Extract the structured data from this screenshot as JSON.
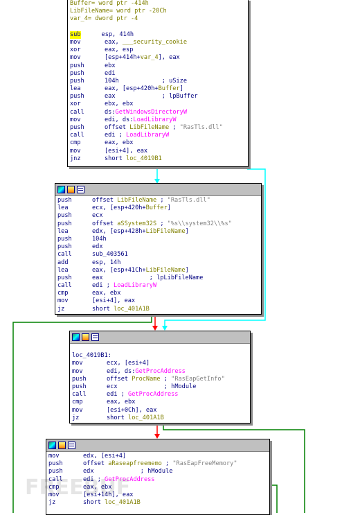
{
  "blocks": [
    {
      "id": "block-1",
      "titlebar": false,
      "lines": [
        [
          {
            "t": "Buffer= word ptr -414h",
            "c": "name"
          }
        ],
        [
          {
            "t": "LibFileName= word ptr -20Ch",
            "c": "name"
          }
        ],
        [
          {
            "t": "var_4= dword ptr -4",
            "c": "name"
          }
        ],
        [
          {
            "t": "",
            "c": ""
          }
        ],
        [
          {
            "t": "sub",
            "c": "hl",
            "m": 1
          },
          {
            "t": "esp, 414h",
            "c": ""
          }
        ],
        [
          {
            "t": "mov",
            "c": "",
            "m": 1
          },
          {
            "t": "eax, ",
            "c": ""
          },
          {
            "t": "___security_cookie",
            "c": "name"
          }
        ],
        [
          {
            "t": "xor",
            "c": "",
            "m": 1
          },
          {
            "t": "eax, esp",
            "c": ""
          }
        ],
        [
          {
            "t": "mov",
            "c": "",
            "m": 1
          },
          {
            "t": "[esp+414h+",
            "c": ""
          },
          {
            "t": "var_4",
            "c": "name"
          },
          {
            "t": "], eax",
            "c": ""
          }
        ],
        [
          {
            "t": "push",
            "c": "",
            "m": 1
          },
          {
            "t": "ebx",
            "c": ""
          }
        ],
        [
          {
            "t": "push",
            "c": "",
            "m": 1
          },
          {
            "t": "edi",
            "c": ""
          }
        ],
        [
          {
            "t": "push",
            "c": "",
            "m": 1
          },
          {
            "t": "104h            ",
            "c": ""
          },
          {
            "t": "; uSize",
            "c": ""
          }
        ],
        [
          {
            "t": "lea",
            "c": "",
            "m": 1
          },
          {
            "t": "eax, [esp+420h+",
            "c": ""
          },
          {
            "t": "Buffer",
            "c": "name"
          },
          {
            "t": "]",
            "c": ""
          }
        ],
        [
          {
            "t": "push",
            "c": "",
            "m": 1
          },
          {
            "t": "eax             ",
            "c": ""
          },
          {
            "t": "; lpBuffer",
            "c": ""
          }
        ],
        [
          {
            "t": "xor",
            "c": "",
            "m": 1
          },
          {
            "t": "ebx, ebx",
            "c": ""
          }
        ],
        [
          {
            "t": "call",
            "c": "",
            "m": 1
          },
          {
            "t": "ds:",
            "c": ""
          },
          {
            "t": "GetWindowsDirectoryW",
            "c": "api"
          }
        ],
        [
          {
            "t": "mov",
            "c": "",
            "m": 1
          },
          {
            "t": "edi, ds:",
            "c": ""
          },
          {
            "t": "LoadLibraryW",
            "c": "api"
          }
        ],
        [
          {
            "t": "push",
            "c": "",
            "m": 1
          },
          {
            "t": "offset ",
            "c": ""
          },
          {
            "t": "LibFileName",
            "c": "name"
          },
          {
            "t": " ; ",
            "c": ""
          },
          {
            "t": "\"RasTls.dll\"",
            "c": "cmt"
          }
        ],
        [
          {
            "t": "call",
            "c": "",
            "m": 1
          },
          {
            "t": "edi ; ",
            "c": ""
          },
          {
            "t": "LoadLibraryW",
            "c": "api"
          }
        ],
        [
          {
            "t": "cmp",
            "c": "",
            "m": 1
          },
          {
            "t": "eax, ebx",
            "c": ""
          }
        ],
        [
          {
            "t": "mov",
            "c": "",
            "m": 1
          },
          {
            "t": "[esi+4], eax",
            "c": ""
          }
        ],
        [
          {
            "t": "jnz",
            "c": "",
            "m": 1
          },
          {
            "t": "short ",
            "c": ""
          },
          {
            "t": "loc_4019B1",
            "c": "name"
          }
        ]
      ]
    },
    {
      "id": "block-2",
      "titlebar": true,
      "lines": [
        [
          {
            "t": "push",
            "c": "",
            "m": 1
          },
          {
            "t": "offset ",
            "c": ""
          },
          {
            "t": "LibFileName",
            "c": "name"
          },
          {
            "t": " ; ",
            "c": ""
          },
          {
            "t": "\"RasTls.dll\"",
            "c": "cmt"
          }
        ],
        [
          {
            "t": "lea",
            "c": "",
            "m": 1
          },
          {
            "t": "ecx, [esp+420h+",
            "c": ""
          },
          {
            "t": "Buffer",
            "c": "name"
          },
          {
            "t": "]",
            "c": ""
          }
        ],
        [
          {
            "t": "push",
            "c": "",
            "m": 1
          },
          {
            "t": "ecx",
            "c": ""
          }
        ],
        [
          {
            "t": "push",
            "c": "",
            "m": 1
          },
          {
            "t": "offset ",
            "c": ""
          },
          {
            "t": "aSSystem32S",
            "c": "name"
          },
          {
            "t": " ; ",
            "c": ""
          },
          {
            "t": "\"%s\\\\system32\\\\%s\"",
            "c": "cmt"
          }
        ],
        [
          {
            "t": "lea",
            "c": "",
            "m": 1
          },
          {
            "t": "edx, [esp+428h+",
            "c": ""
          },
          {
            "t": "LibFileName",
            "c": "name"
          },
          {
            "t": "]",
            "c": ""
          }
        ],
        [
          {
            "t": "push",
            "c": "",
            "m": 1
          },
          {
            "t": "104h",
            "c": ""
          }
        ],
        [
          {
            "t": "push",
            "c": "",
            "m": 1
          },
          {
            "t": "edx",
            "c": ""
          }
        ],
        [
          {
            "t": "call",
            "c": "",
            "m": 1
          },
          {
            "t": "sub_403561",
            "c": ""
          }
        ],
        [
          {
            "t": "add",
            "c": "",
            "m": 1
          },
          {
            "t": "esp, 14h",
            "c": ""
          }
        ],
        [
          {
            "t": "lea",
            "c": "",
            "m": 1
          },
          {
            "t": "eax, [esp+41Ch+",
            "c": ""
          },
          {
            "t": "LibFileName",
            "c": "name"
          },
          {
            "t": "]",
            "c": ""
          }
        ],
        [
          {
            "t": "push",
            "c": "",
            "m": 1
          },
          {
            "t": "eax             ",
            "c": ""
          },
          {
            "t": "; lpLibFileName",
            "c": ""
          }
        ],
        [
          {
            "t": "call",
            "c": "",
            "m": 1
          },
          {
            "t": "edi ; ",
            "c": ""
          },
          {
            "t": "LoadLibraryW",
            "c": "api"
          }
        ],
        [
          {
            "t": "cmp",
            "c": "",
            "m": 1
          },
          {
            "t": "eax, ebx",
            "c": ""
          }
        ],
        [
          {
            "t": "mov",
            "c": "",
            "m": 1
          },
          {
            "t": "[esi+4], eax",
            "c": ""
          }
        ],
        [
          {
            "t": "jz",
            "c": "",
            "m": 1
          },
          {
            "t": "short ",
            "c": ""
          },
          {
            "t": "loc_401A1B",
            "c": "name"
          }
        ]
      ]
    },
    {
      "id": "block-3",
      "titlebar": true,
      "lines": [
        [
          {
            "t": "",
            "c": ""
          }
        ],
        [
          {
            "t": "loc_4019B1:",
            "c": ""
          }
        ],
        [
          {
            "t": "mov",
            "c": "",
            "m": 1
          },
          {
            "t": "ecx, [esi+4]",
            "c": ""
          }
        ],
        [
          {
            "t": "mov",
            "c": "",
            "m": 1
          },
          {
            "t": "edi, ds:",
            "c": ""
          },
          {
            "t": "GetProcAddress",
            "c": "api"
          }
        ],
        [
          {
            "t": "push",
            "c": "",
            "m": 1
          },
          {
            "t": "offset ",
            "c": ""
          },
          {
            "t": "ProcName",
            "c": "name"
          },
          {
            "t": " ; ",
            "c": ""
          },
          {
            "t": "\"RasEapGetInfo\"",
            "c": "cmt"
          }
        ],
        [
          {
            "t": "push",
            "c": "",
            "m": 1
          },
          {
            "t": "ecx             ",
            "c": ""
          },
          {
            "t": "; hModule",
            "c": ""
          }
        ],
        [
          {
            "t": "call",
            "c": "",
            "m": 1
          },
          {
            "t": "edi ; ",
            "c": ""
          },
          {
            "t": "GetProcAddress",
            "c": "api"
          }
        ],
        [
          {
            "t": "cmp",
            "c": "",
            "m": 1
          },
          {
            "t": "eax, ebx",
            "c": ""
          }
        ],
        [
          {
            "t": "mov",
            "c": "",
            "m": 1
          },
          {
            "t": "[esi+0Ch], eax",
            "c": ""
          }
        ],
        [
          {
            "t": "jz",
            "c": "",
            "m": 1
          },
          {
            "t": "short ",
            "c": ""
          },
          {
            "t": "loc_401A1B",
            "c": "name"
          }
        ]
      ]
    },
    {
      "id": "block-4",
      "titlebar": true,
      "lines": [
        [
          {
            "t": "mov",
            "c": "",
            "m": 1
          },
          {
            "t": "edx, [esi+4]",
            "c": ""
          }
        ],
        [
          {
            "t": "push",
            "c": "",
            "m": 1
          },
          {
            "t": "offset ",
            "c": ""
          },
          {
            "t": "aRaseapfreememo",
            "c": "name"
          },
          {
            "t": " ; ",
            "c": ""
          },
          {
            "t": "\"RasEapFreeMemory\"",
            "c": "cmt"
          }
        ],
        [
          {
            "t": "push",
            "c": "",
            "m": 1
          },
          {
            "t": "edx             ",
            "c": ""
          },
          {
            "t": "; hModule",
            "c": ""
          }
        ],
        [
          {
            "t": "call",
            "c": "",
            "m": 1
          },
          {
            "t": "edi ; ",
            "c": ""
          },
          {
            "t": "GetProcAddress",
            "c": "api"
          }
        ],
        [
          {
            "t": "cmp",
            "c": "",
            "m": 1
          },
          {
            "t": "eax, ebx",
            "c": ""
          }
        ],
        [
          {
            "t": "mov",
            "c": "",
            "m": 1
          },
          {
            "t": "[esi+14h], eax",
            "c": ""
          }
        ],
        [
          {
            "t": "jz",
            "c": "",
            "m": 1
          },
          {
            "t": "short ",
            "c": ""
          },
          {
            "t": "loc_401A1B",
            "c": "name"
          }
        ]
      ]
    }
  ],
  "edge_colors": {
    "true_branch": "#00ffff",
    "false_branch": "#ff0000",
    "jump_taken": "#008000"
  },
  "watermark": "FREEBUF"
}
